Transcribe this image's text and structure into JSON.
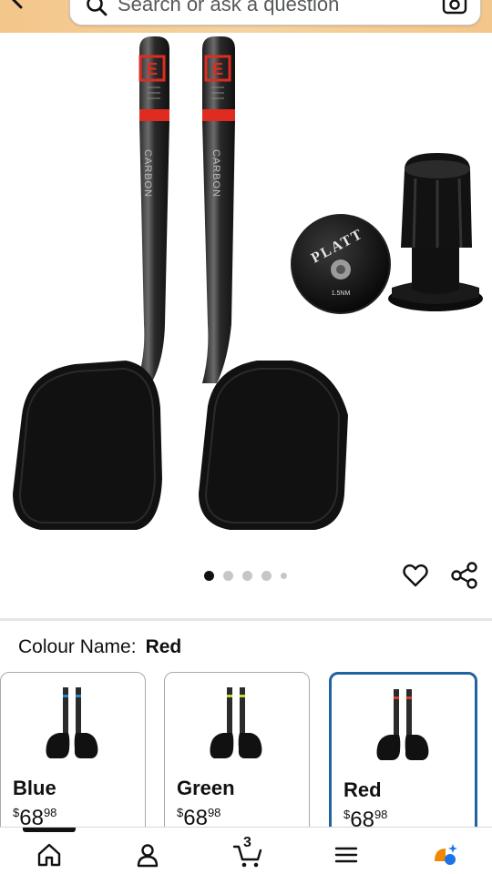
{
  "search": {
    "placeholder": "Search or ask a question"
  },
  "product": {
    "image_alt": "Aero bar extensions with arm pads and bar end plugs",
    "image_text": {
      "shaft_label": "CARBON",
      "plug_brand": "PLATT",
      "torque": "1.5NM"
    }
  },
  "carousel": {
    "total_dots": 5,
    "active_index": 0
  },
  "colour": {
    "label": "Colour Name:",
    "selected": "Red",
    "options": [
      {
        "name": "Blue",
        "currency": "$",
        "whole": "68",
        "cents": "98",
        "accent": "#2a86c9"
      },
      {
        "name": "Green",
        "currency": "$",
        "whole": "68",
        "cents": "98",
        "accent": "#c9d633"
      },
      {
        "name": "Red",
        "currency": "$",
        "whole": "68",
        "cents": "98",
        "accent": "#d83a2b"
      }
    ]
  },
  "nav": {
    "items": [
      {
        "icon": "home-icon"
      },
      {
        "icon": "account-icon"
      },
      {
        "icon": "cart-icon",
        "badge": "3"
      },
      {
        "icon": "menu-icon"
      },
      {
        "icon": "rufus-icon"
      }
    ]
  },
  "colors": {
    "header": "#f3c68a",
    "selected_border": "#2162a1",
    "accent_red": "#e02b20"
  }
}
